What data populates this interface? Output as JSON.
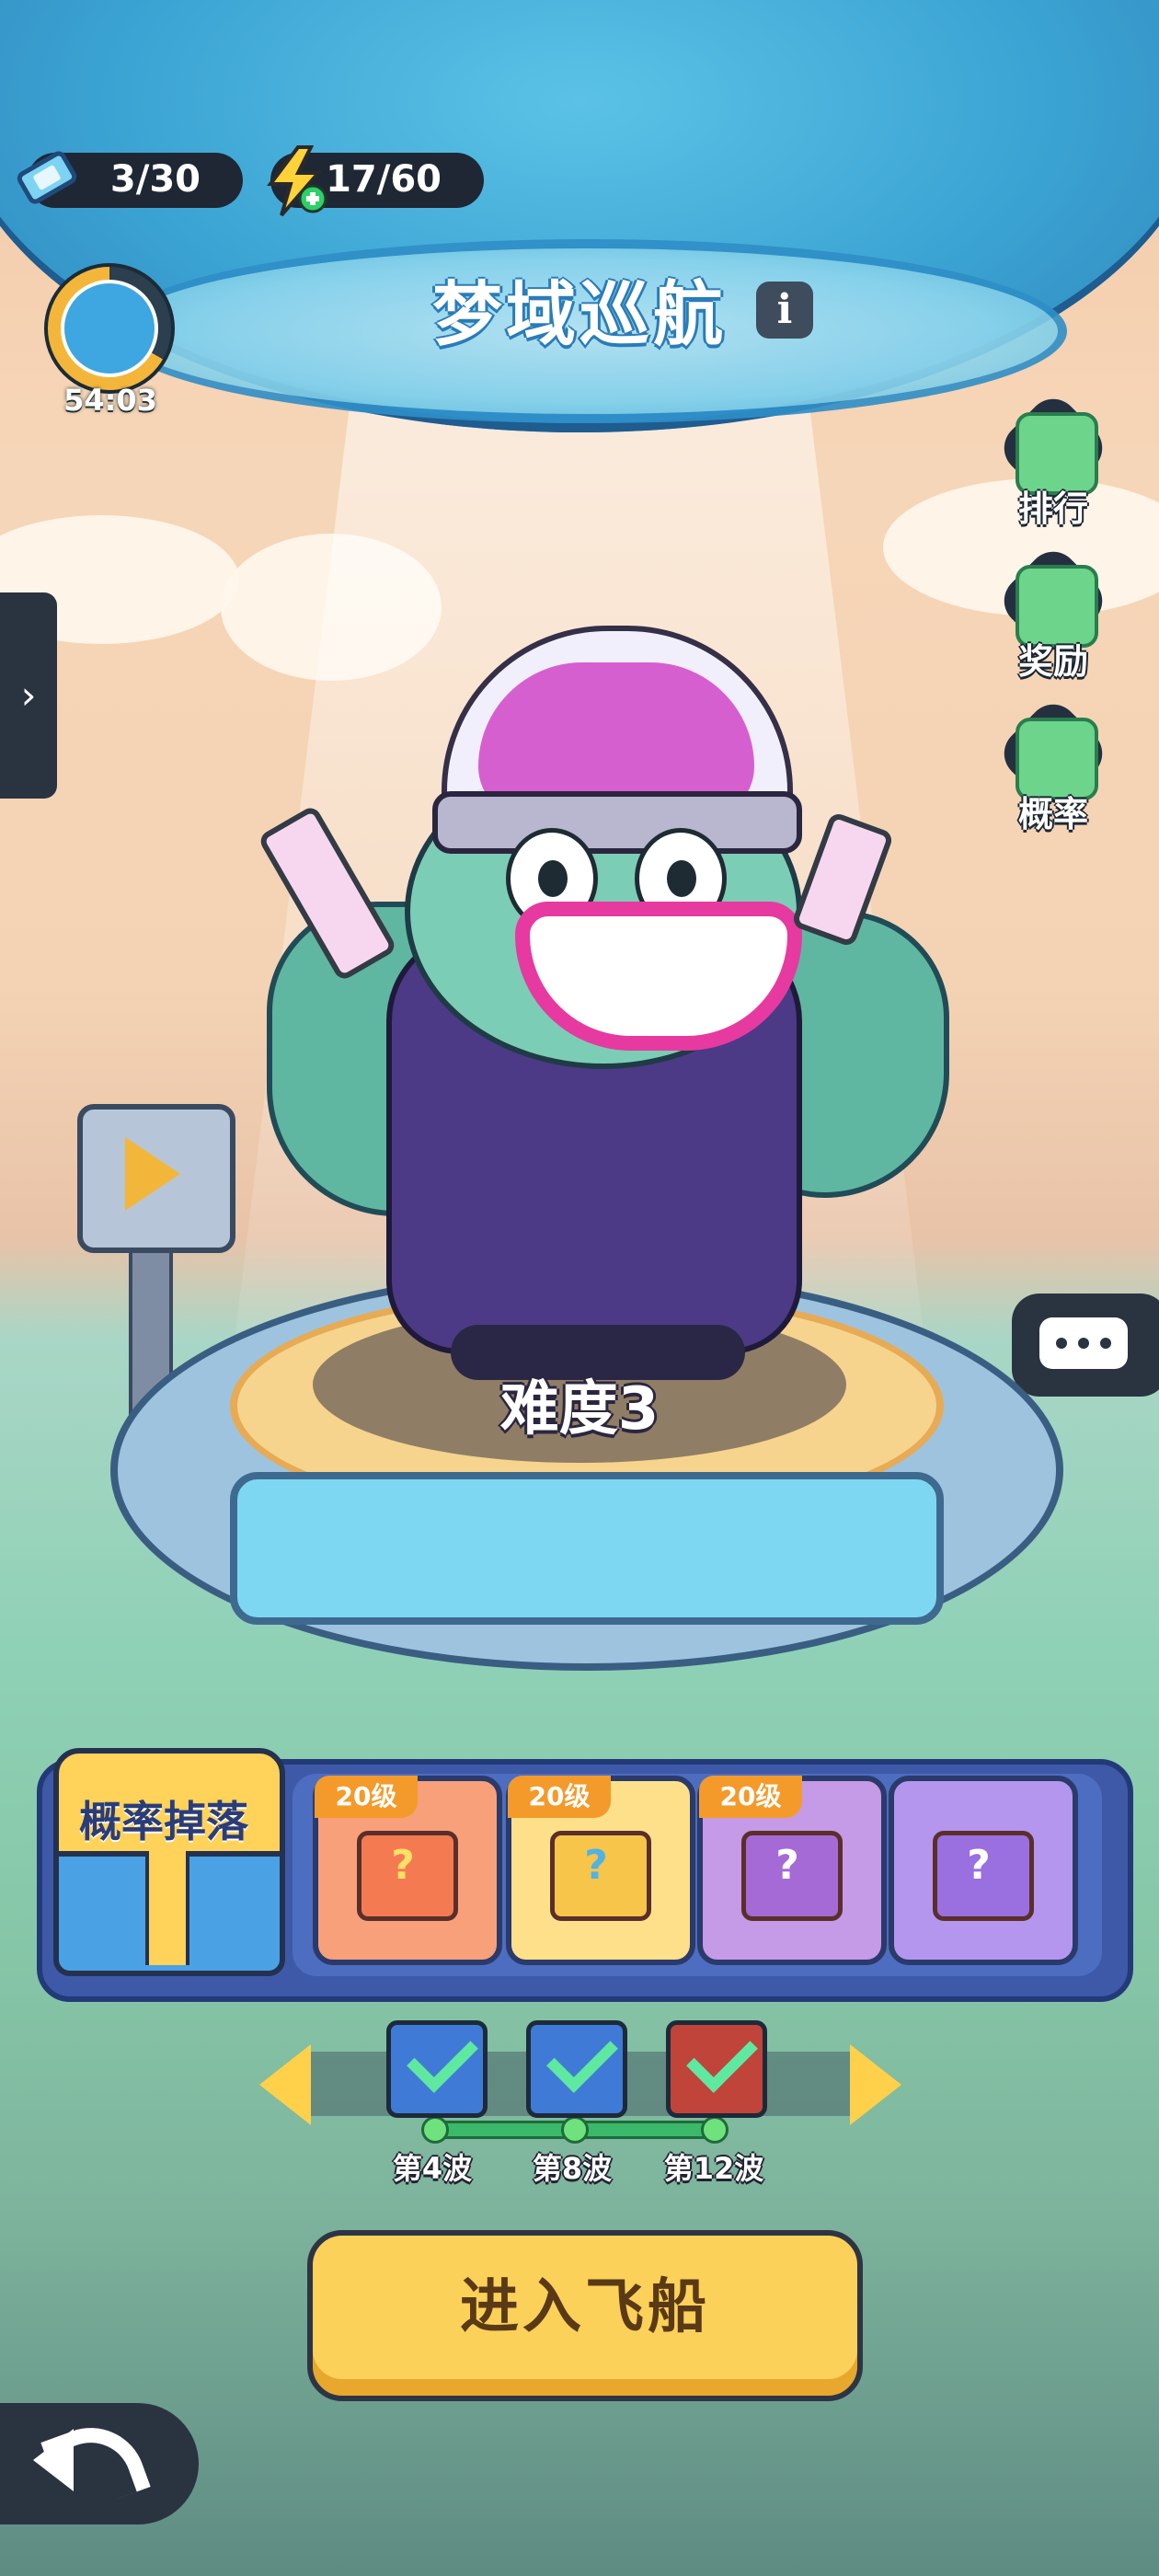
{
  "hud": {
    "tickets": "3/30",
    "energy": "17/60",
    "timer": "54:03"
  },
  "title": "梦域巡航",
  "info_label": "i",
  "side_buttons": [
    {
      "label": "排行",
      "icon": "magnifier-icon"
    },
    {
      "label": "奖励",
      "icon": "gift-icon"
    },
    {
      "label": "概率",
      "icon": "question-cube-icon"
    }
  ],
  "difficulty": "难度3",
  "drop_panel": {
    "chest_label": "概率掉落",
    "boxes": [
      {
        "level": "20级",
        "color": "#f47a52",
        "q": "?"
      },
      {
        "level": "20级",
        "color": "#f6c54a",
        "q": "?"
      },
      {
        "level": "20级",
        "color": "#a56ad6",
        "q": "?"
      },
      {
        "level": "",
        "color": "#9a6fe0",
        "q": "?"
      }
    ]
  },
  "waves": [
    {
      "label": "第4波",
      "color": "#3f7bd6",
      "completed": true
    },
    {
      "label": "第8波",
      "color": "#3f7bd6",
      "completed": true
    },
    {
      "label": "第12波",
      "color": "#c0443a",
      "completed": true
    }
  ],
  "enter_button": "进入飞船",
  "colors": {
    "accent_yellow": "#fbd159",
    "panel_blue": "#3e59a8",
    "dark_ui": "#2a3440"
  }
}
